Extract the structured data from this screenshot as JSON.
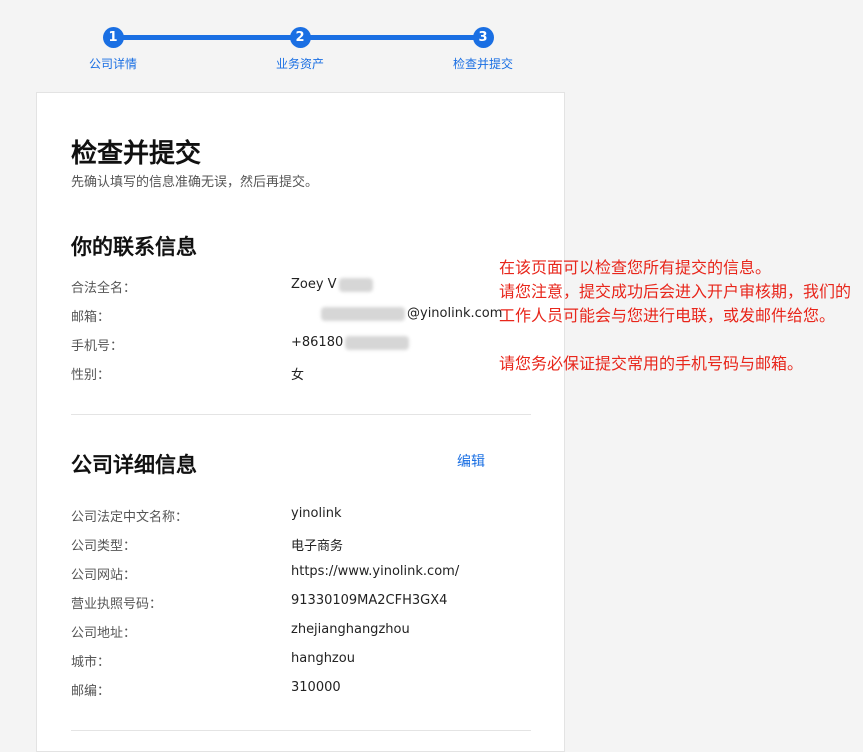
{
  "stepper": {
    "steps": [
      {
        "number": "1",
        "label": "公司详情"
      },
      {
        "number": "2",
        "label": "业务资产"
      },
      {
        "number": "3",
        "label": "检查并提交"
      }
    ]
  },
  "page": {
    "title": "检查并提交",
    "subtitle": "先确认填写的信息准确无误，然后再提交。"
  },
  "contact": {
    "title": "你的联系信息",
    "fields": [
      {
        "key": "合法全名：",
        "value": "Zoey V"
      },
      {
        "key": "邮箱：",
        "value": "@yinolink.com"
      },
      {
        "key": "手机号：",
        "value": "+86180"
      },
      {
        "key": "性别：",
        "value": "女"
      }
    ]
  },
  "company": {
    "title": "公司详细信息",
    "edit_label": "编辑",
    "fields": [
      {
        "key": "公司法定中文名称：",
        "value": "yinolink"
      },
      {
        "key": "公司类型：",
        "value": "电子商务"
      },
      {
        "key": "公司网站：",
        "value": "https://www.yinolink.com/"
      },
      {
        "key": "营业执照号码：",
        "value": "91330109MA2CFH3GX4"
      },
      {
        "key": "公司地址：",
        "value": "zhejianghangzhou"
      },
      {
        "key": "城市：",
        "value": "hanghzou"
      },
      {
        "key": "邮编：",
        "value": "310000"
      }
    ]
  },
  "annotation": {
    "lines": [
      "在该页面可以检查您所有提交的信息。",
      "请您注意，提交成功后会进入开户审核期，我们的工作人员可能会与您进行电联，或发邮件给您。",
      "请您务必保证提交常用的手机号码与邮箱。"
    ]
  },
  "colors": {
    "accent": "#1a6fe3",
    "annotation": "#e8261b"
  }
}
